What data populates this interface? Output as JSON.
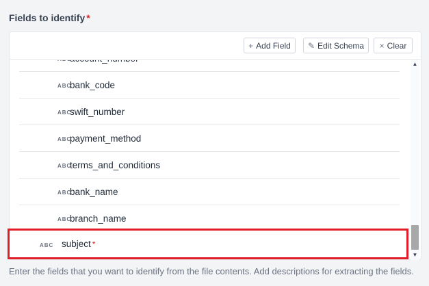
{
  "section": {
    "label": "Fields to identify",
    "required_mark": "*"
  },
  "toolbar": {
    "add_icon": "+",
    "add_label": "Add Field",
    "edit_icon": "✎",
    "edit_label": "Edit Schema",
    "clear_icon": "×",
    "clear_label": "Clear"
  },
  "fields": [
    {
      "type": "ABC",
      "name": "account_number"
    },
    {
      "type": "ABC",
      "name": "bank_code"
    },
    {
      "type": "ABC",
      "name": "swift_number"
    },
    {
      "type": "ABC",
      "name": "payment_method"
    },
    {
      "type": "ABC",
      "name": "terms_and_conditions"
    },
    {
      "type": "ABC",
      "name": "bank_name"
    },
    {
      "type": "ABC",
      "name": "branch_name"
    }
  ],
  "selected_field": {
    "type": "ABC",
    "name": "subject",
    "required_mark": "*"
  },
  "scroll": {
    "up_icon": "▲",
    "down_icon": "▼"
  },
  "helper_text": "Enter the fields that you want to identify from the file contents. Add descriptions for extracting the fields.",
  "colors": {
    "highlight_border": "#e11d2a",
    "required": "#dc2626"
  }
}
